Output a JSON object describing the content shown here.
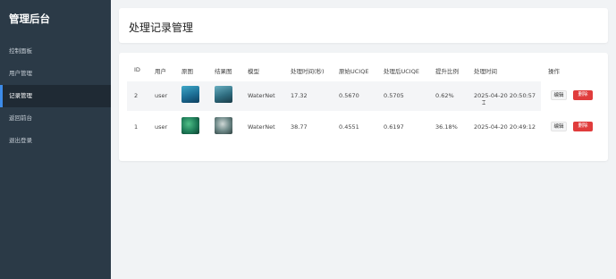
{
  "sidebar": {
    "brand": "管理后台",
    "items": [
      {
        "label": "控制面板"
      },
      {
        "label": "用户管理"
      },
      {
        "label": "记录管理"
      },
      {
        "label": "返回前台"
      },
      {
        "label": "退出登录"
      }
    ],
    "active_index": 2
  },
  "header": {
    "title": "处理记录管理"
  },
  "table": {
    "columns": [
      "ID",
      "用户",
      "原图",
      "结果图",
      "模型",
      "处理时间(秒)",
      "原始UCIQE",
      "处理后UCIQE",
      "提升比例",
      "处理时间",
      "操作"
    ],
    "rows": [
      {
        "id": "2",
        "user": "user",
        "model": "WaterNet",
        "proc_seconds": "17.32",
        "orig_uciqe": "0.5670",
        "proc_uciqe": "0.5705",
        "improvement": "0.62%",
        "time": "2025-04-20 20:50:57"
      },
      {
        "id": "1",
        "user": "user",
        "model": "WaterNet",
        "proc_seconds": "38.77",
        "orig_uciqe": "0.4551",
        "proc_uciqe": "0.6197",
        "improvement": "36.18%",
        "time": "2025-04-20 20:49:12"
      }
    ],
    "actions": {
      "edit_label": "编辑",
      "delete_label": "删除"
    }
  },
  "colors": {
    "sidebar_bg": "#2b3a47",
    "active_accent": "#3d8be8",
    "delete_button": "#e03c3c"
  },
  "icons": {
    "cursor": "text-cursor-icon"
  }
}
